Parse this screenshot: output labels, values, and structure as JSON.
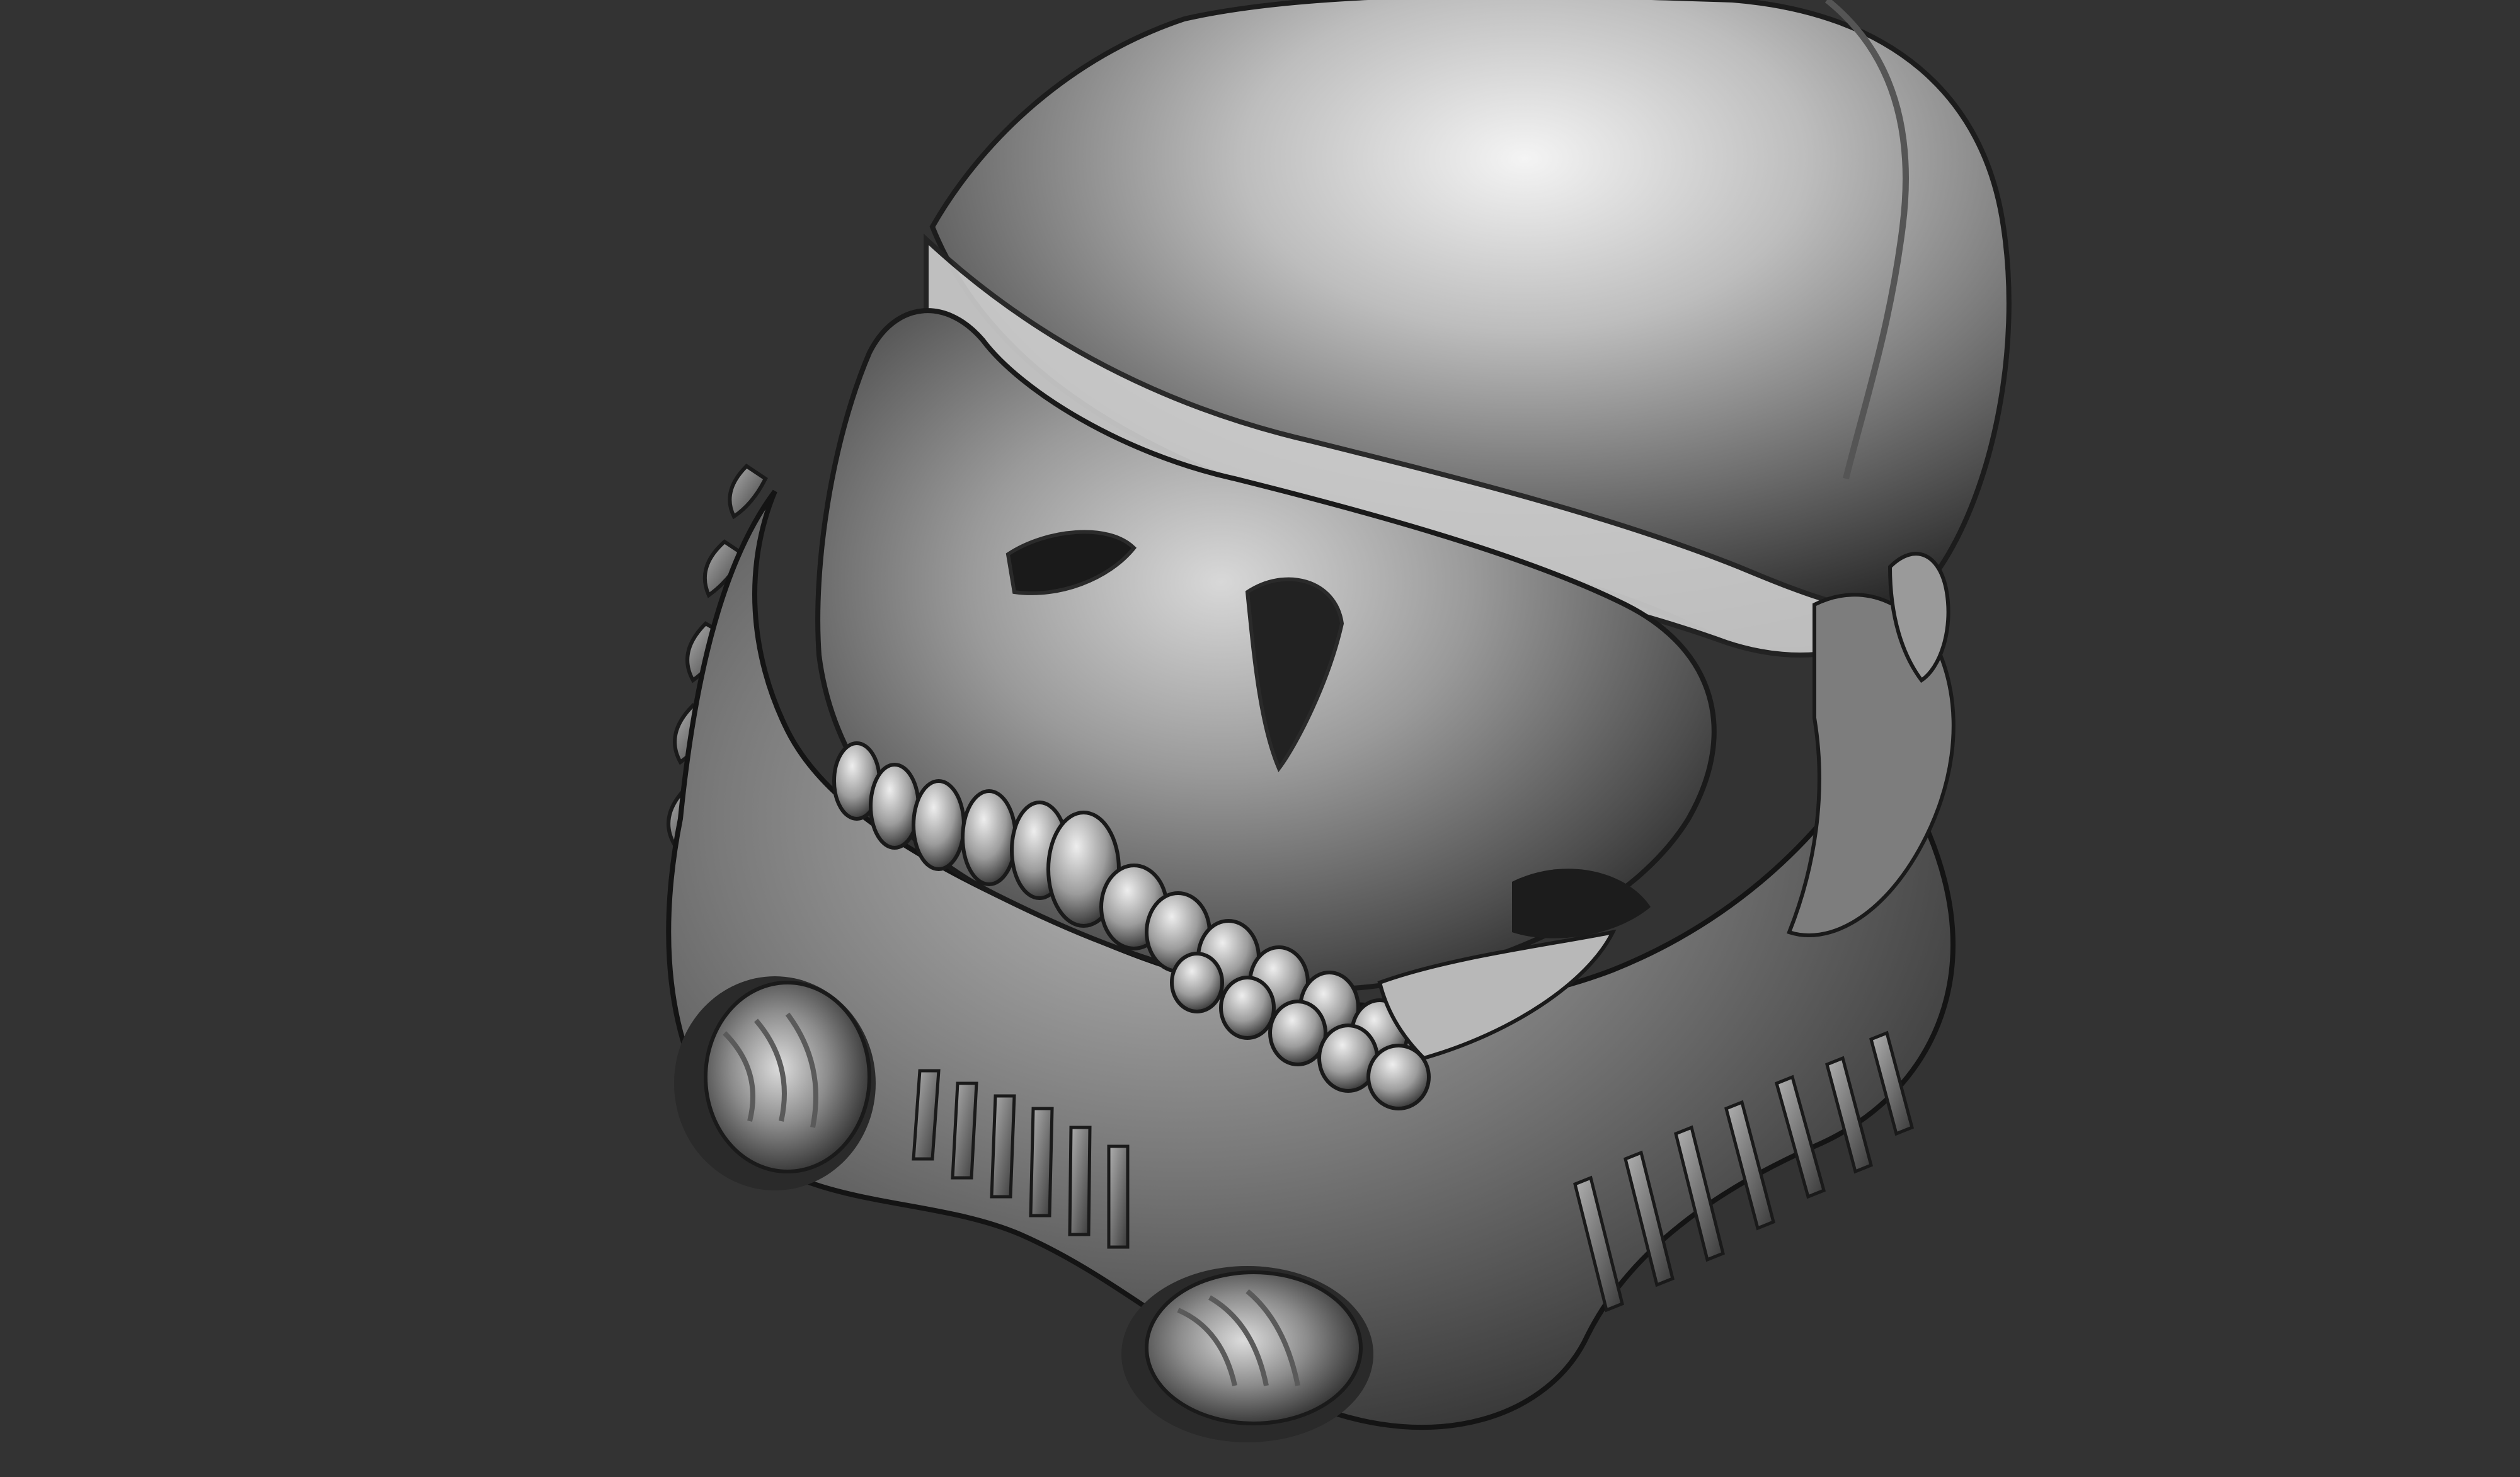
{
  "scene": {
    "background_color": "#333333",
    "subject": "sculpted-skull-helmet",
    "material": "matcap-grey"
  },
  "palette": {
    "highlight": "#f2f2f2",
    "light": "#c9c9c9",
    "mid": "#8f8f8f",
    "dark": "#4a4a4a",
    "shadow": "#161616"
  }
}
